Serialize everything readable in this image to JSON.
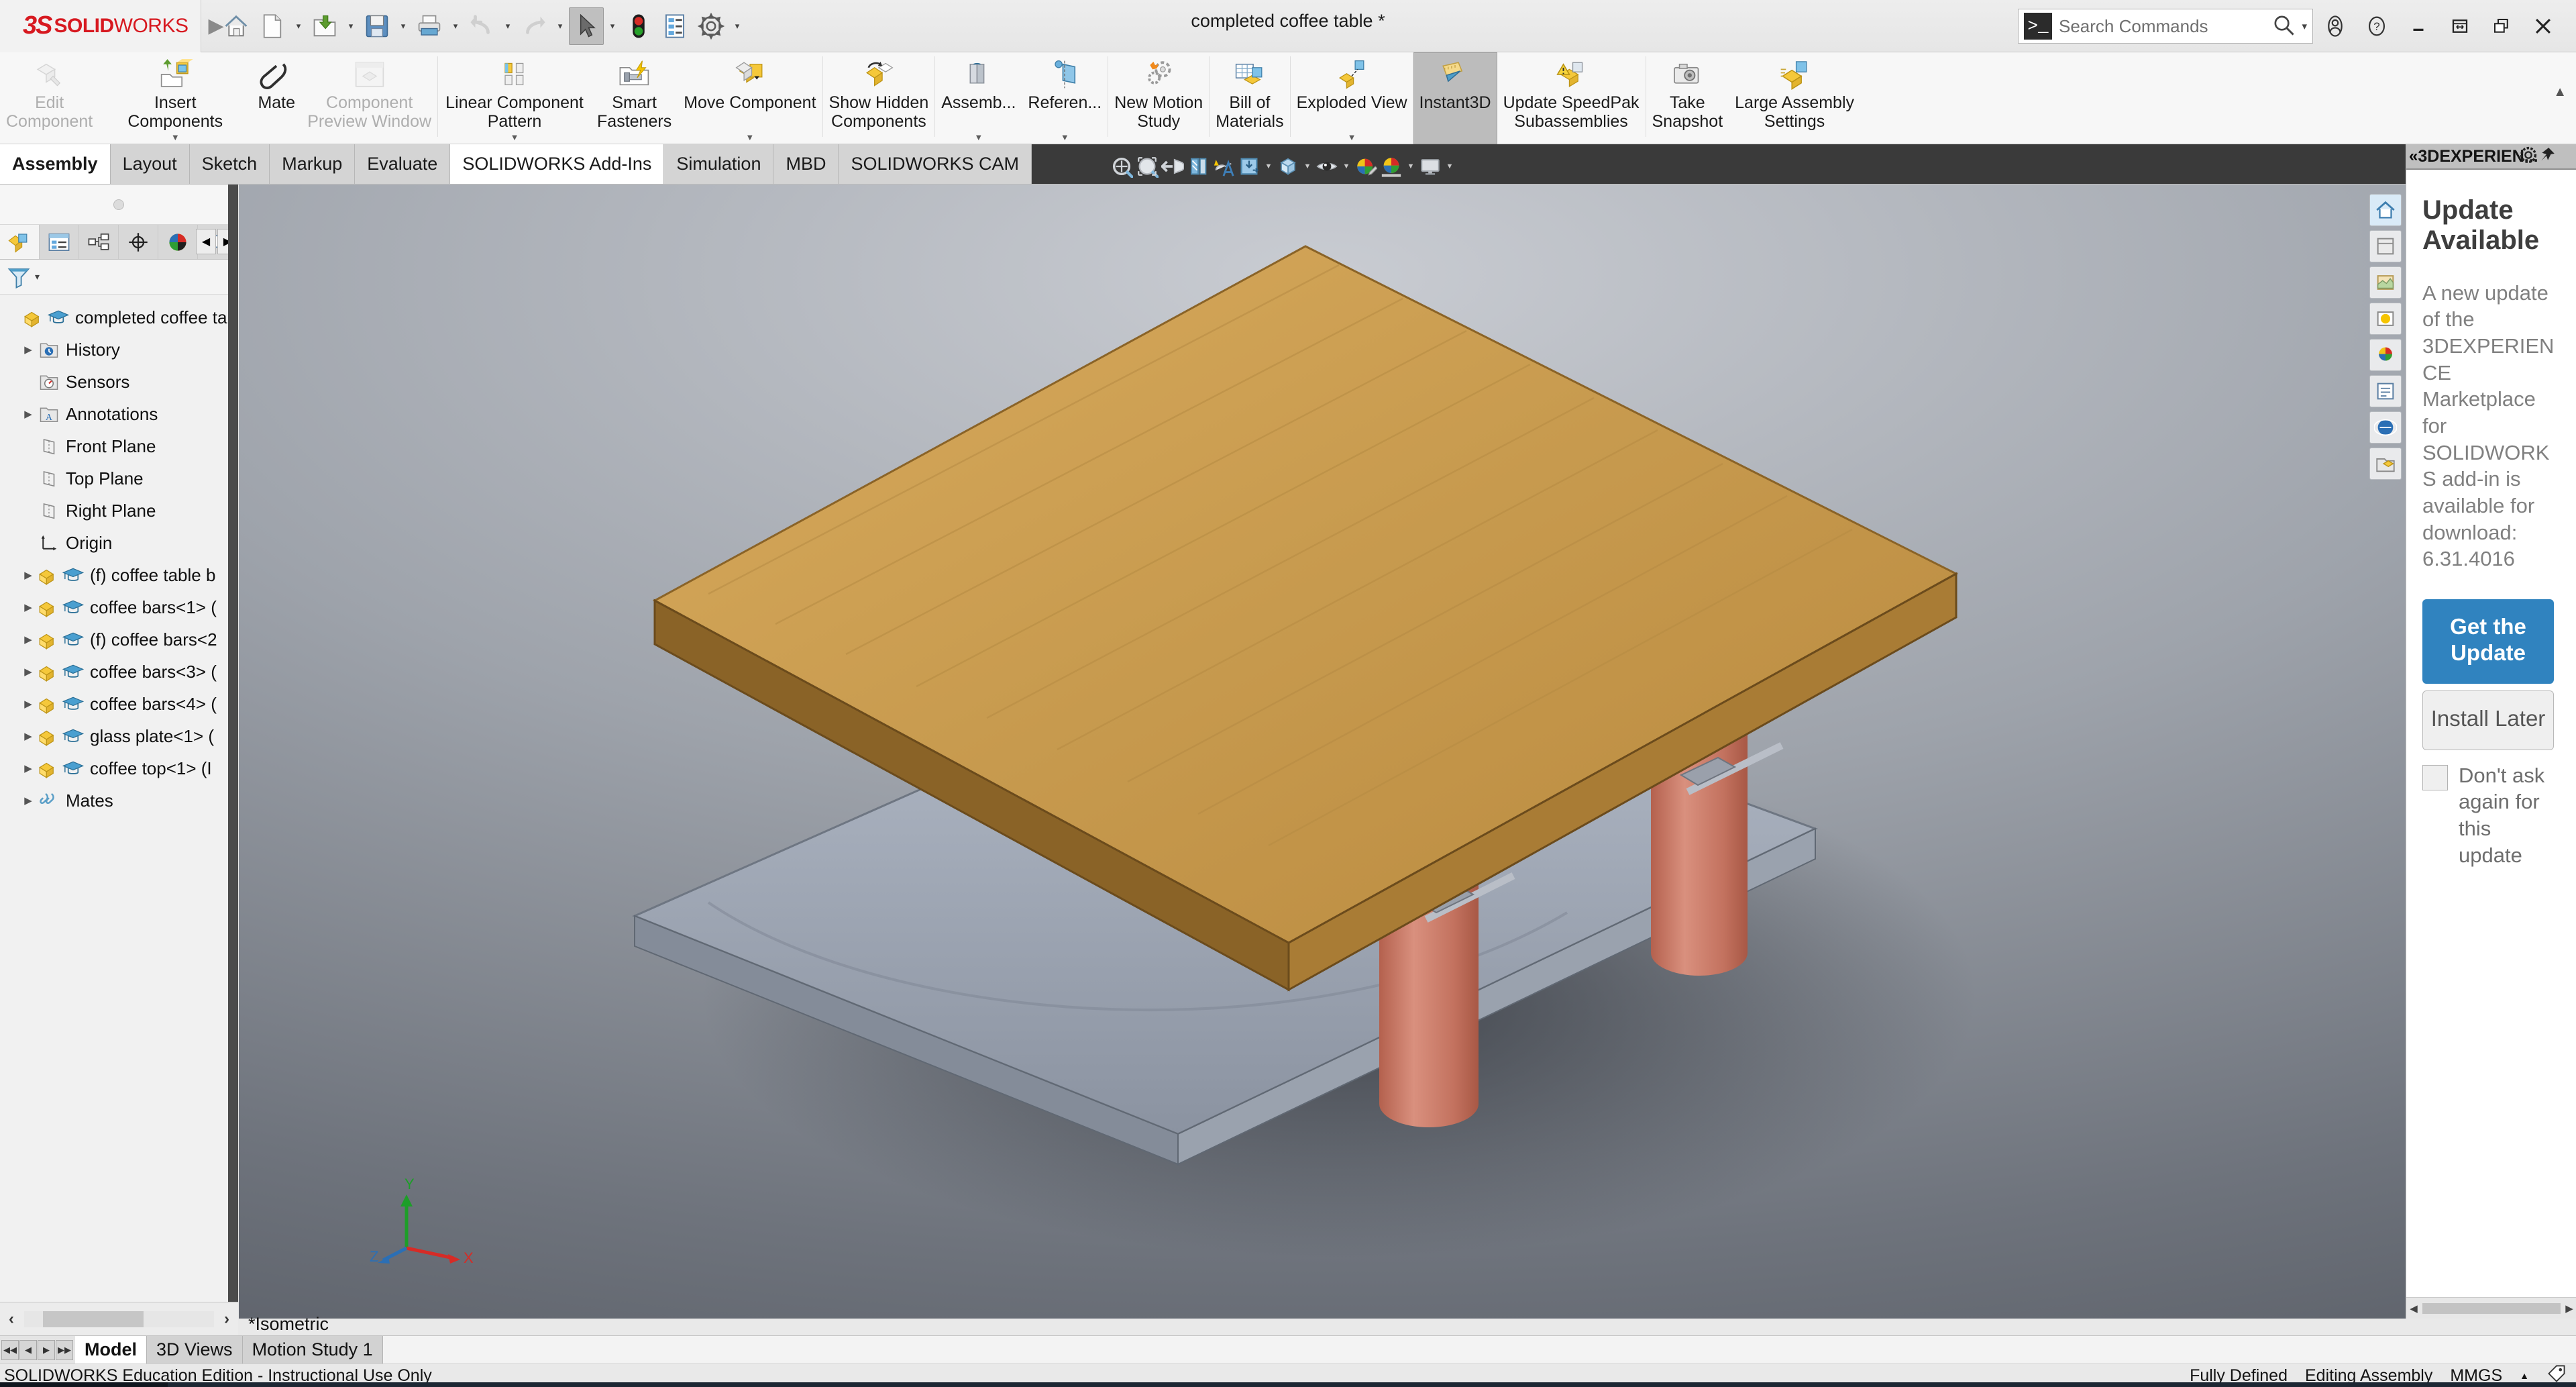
{
  "app": {
    "brand_ds": "3S",
    "brand_solid": "SOLID",
    "brand_works": "WORKS",
    "window_title": "completed coffee table *"
  },
  "quick_access": {
    "items": [
      {
        "name": "home-icon",
        "caret": false
      },
      {
        "name": "new-document-icon",
        "caret": true
      },
      {
        "name": "open-folder-icon",
        "caret": true
      },
      {
        "name": "save-icon",
        "caret": true
      },
      {
        "name": "print-icon",
        "caret": true
      },
      {
        "name": "undo-icon",
        "caret": true
      },
      {
        "name": "redo-icon",
        "caret": true
      },
      {
        "name": "select-arrow-icon",
        "caret": true,
        "active": true
      },
      {
        "name": "rebuild-traffic-light-icon",
        "caret": false
      },
      {
        "name": "file-properties-icon",
        "caret": false
      },
      {
        "name": "options-gear-icon",
        "caret": true
      }
    ]
  },
  "search": {
    "prompt_glyph": ">_",
    "placeholder": "Search Commands",
    "icon": "search-icon",
    "caret": "chevron-down-icon"
  },
  "window_controls": {
    "account": "user-account-icon",
    "help": "help-question-icon",
    "minimize": "minimize-icon",
    "restore": "restore-window-icon",
    "cascade": "cascade-window-icon",
    "close": "close-icon"
  },
  "ribbon": {
    "items": [
      {
        "label": "Edit\nComponent",
        "icon": "edit-component-icon",
        "dimmed": true,
        "dropdown": false
      },
      {
        "label": "Insert Components",
        "icon": "insert-components-icon",
        "dimmed": false,
        "dropdown": true
      },
      {
        "label": "Mate",
        "icon": "mate-paperclip-icon",
        "dimmed": false,
        "dropdown": false
      },
      {
        "label": "Component\nPreview Window",
        "icon": "component-preview-window-icon",
        "dimmed": true,
        "dropdown": false
      },
      {
        "sep": true
      },
      {
        "label": "Linear Component Pattern",
        "icon": "linear-component-pattern-icon",
        "dimmed": false,
        "dropdown": true
      },
      {
        "label": "Smart\nFasteners",
        "icon": "smart-fasteners-icon",
        "dimmed": false,
        "dropdown": false
      },
      {
        "label": "Move Component",
        "icon": "move-component-icon",
        "dimmed": false,
        "dropdown": true
      },
      {
        "sep": true
      },
      {
        "label": "Show Hidden\nComponents",
        "icon": "show-hidden-components-icon",
        "dimmed": false,
        "dropdown": false
      },
      {
        "sep": true
      },
      {
        "label": "Assemb...",
        "icon": "assembly-features-icon",
        "dimmed": false,
        "dropdown": true
      },
      {
        "label": "Referen...",
        "icon": "reference-geometry-icon",
        "dimmed": false,
        "dropdown": true
      },
      {
        "sep": true
      },
      {
        "label": "New Motion\nStudy",
        "icon": "new-motion-study-icon",
        "dimmed": false,
        "dropdown": false
      },
      {
        "sep": true
      },
      {
        "label": "Bill of\nMaterials",
        "icon": "bill-of-materials-icon",
        "dimmed": false,
        "dropdown": false
      },
      {
        "sep": true
      },
      {
        "label": "Exploded View",
        "icon": "exploded-view-icon",
        "dimmed": false,
        "dropdown": true
      },
      {
        "label": "Instant3D",
        "icon": "instant3d-icon",
        "dimmed": false,
        "dropdown": false,
        "selected": true
      },
      {
        "label": "Update SpeedPak\nSubassemblies",
        "icon": "update-speedpak-icon",
        "dimmed": false,
        "dropdown": false
      },
      {
        "sep": true
      },
      {
        "label": "Take\nSnapshot",
        "icon": "take-snapshot-camera-icon",
        "dimmed": false,
        "dropdown": false
      },
      {
        "label": "Large Assembly\nSettings",
        "icon": "large-assembly-settings-icon",
        "dimmed": false,
        "dropdown": false
      }
    ]
  },
  "command_tabs": [
    {
      "label": "Assembly",
      "state": "active"
    },
    {
      "label": "Layout",
      "state": "normal"
    },
    {
      "label": "Sketch",
      "state": "normal"
    },
    {
      "label": "Markup",
      "state": "normal"
    },
    {
      "label": "Evaluate",
      "state": "normal"
    },
    {
      "label": "SOLIDWORKS Add-Ins",
      "state": "white"
    },
    {
      "label": "Simulation",
      "state": "normal"
    },
    {
      "label": "MBD",
      "state": "normal"
    },
    {
      "label": "SOLIDWORKS CAM",
      "state": "normal"
    }
  ],
  "view_toolbar": [
    {
      "name": "zoom-to-fit-icon",
      "caret": false
    },
    {
      "name": "zoom-to-area-icon",
      "caret": false
    },
    {
      "name": "previous-view-icon",
      "caret": false
    },
    {
      "name": "section-view-icon",
      "caret": false
    },
    {
      "name": "view-annotations-icon",
      "caret": false
    },
    {
      "name": "view-orientation-icon",
      "caret": true
    },
    {
      "name": "display-style-icon",
      "caret": true
    },
    {
      "name": "hide-show-items-icon",
      "caret": true
    },
    {
      "name": "edit-appearance-icon",
      "caret": false
    },
    {
      "name": "apply-scene-icon",
      "caret": true
    },
    {
      "name": "view-settings-icon",
      "caret": true
    }
  ],
  "feature_manager": {
    "tabs": [
      {
        "name": "feature-manager-tab",
        "active": true
      },
      {
        "name": "property-manager-tab",
        "active": false
      },
      {
        "name": "configuration-manager-tab",
        "active": false
      },
      {
        "name": "dimxpert-manager-tab",
        "active": false
      },
      {
        "name": "display-manager-tab",
        "active": false
      },
      {
        "name": "appearances-tab",
        "active": false
      }
    ],
    "nav_prev": "◀",
    "nav_next": "▶",
    "filter_icon": "filter-funnel-icon",
    "tree": [
      {
        "label": "completed coffee ta",
        "indent": 0,
        "twisty": false,
        "icon": "assembly-icon",
        "edu": true
      },
      {
        "label": "History",
        "indent": 1,
        "twisty": true,
        "icon": "history-folder-icon",
        "edu": false
      },
      {
        "label": "Sensors",
        "indent": 1,
        "twisty": false,
        "icon": "sensors-folder-icon",
        "edu": false
      },
      {
        "label": "Annotations",
        "indent": 1,
        "twisty": true,
        "icon": "annotations-folder-icon",
        "edu": false
      },
      {
        "label": "Front Plane",
        "indent": 1,
        "twisty": false,
        "icon": "plane-icon",
        "edu": false
      },
      {
        "label": "Top Plane",
        "indent": 1,
        "twisty": false,
        "icon": "plane-icon",
        "edu": false
      },
      {
        "label": "Right Plane",
        "indent": 1,
        "twisty": false,
        "icon": "plane-icon",
        "edu": false
      },
      {
        "label": "Origin",
        "indent": 1,
        "twisty": false,
        "icon": "origin-icon",
        "edu": false
      },
      {
        "label": "(f) coffee table b",
        "indent": 1,
        "twisty": true,
        "icon": "component-icon",
        "edu": true
      },
      {
        "label": "coffee bars<1> (",
        "indent": 1,
        "twisty": true,
        "icon": "component-icon",
        "edu": true
      },
      {
        "label": "(f) coffee bars<2",
        "indent": 1,
        "twisty": true,
        "icon": "component-icon",
        "edu": true
      },
      {
        "label": "coffee bars<3> (",
        "indent": 1,
        "twisty": true,
        "icon": "component-icon",
        "edu": true
      },
      {
        "label": "coffee bars<4> (",
        "indent": 1,
        "twisty": true,
        "icon": "component-icon",
        "edu": true
      },
      {
        "label": "glass plate<1> (",
        "indent": 1,
        "twisty": true,
        "icon": "component-icon",
        "edu": true
      },
      {
        "label": "coffee top<1> (I",
        "indent": 1,
        "twisty": true,
        "icon": "component-icon",
        "edu": true
      },
      {
        "label": "Mates",
        "indent": 1,
        "twisty": true,
        "icon": "mates-folder-icon",
        "edu": false
      }
    ]
  },
  "graphics": {
    "view_label": "*Isometric",
    "triad": {
      "x": "X",
      "y": "Y",
      "z": "Z"
    },
    "side_buttons": [
      {
        "name": "view-home-icon"
      },
      {
        "name": "view-palette-icon"
      },
      {
        "name": "appearances-library-icon"
      },
      {
        "name": "scenes-lights-icon"
      },
      {
        "name": "decals-icon"
      },
      {
        "name": "custom-properties-icon"
      },
      {
        "name": "3dexperience-icon"
      },
      {
        "name": "design-library-icon"
      }
    ],
    "model_colors": {
      "table_top_wood": "#c79a4e",
      "table_top_edge": "#8a6327",
      "legs": "#c97a67",
      "base_plate": "#9aa1ae",
      "shadow": "#3d4149"
    }
  },
  "task_pane": {
    "header": "3DEXPERIEN...",
    "header_collapse_icon": "collapse-chevrons-icon",
    "header_gear_icon": "gear-icon",
    "header_pin_icon": "pin-icon",
    "title": "Update Available",
    "body": "A new update of the 3DEXPERIENCE Marketplace for SOLIDWORKS add-in is available for download: 6.31.4016",
    "primary_button": "Get the Update",
    "secondary_button": "Install Later",
    "checkbox_label": "Don't ask again for this update",
    "checkbox_checked": false,
    "accent_color": "#3083bf"
  },
  "document_tabs": {
    "nav_glyphs": [
      "◀◀",
      "◀",
      "▶",
      "▶▶"
    ],
    "tabs": [
      {
        "label": "Model",
        "active": true
      },
      {
        "label": "3D Views",
        "active": false
      },
      {
        "label": "Motion Study 1",
        "active": false
      }
    ]
  },
  "status_bar": {
    "left": "SOLIDWORKS Education Edition - Instructional Use Only",
    "fully_defined": "Fully Defined",
    "editing": "Editing Assembly",
    "units": "MMGS",
    "units_caret": "chevron-up-icon",
    "tag_icon": "tag-icon"
  }
}
